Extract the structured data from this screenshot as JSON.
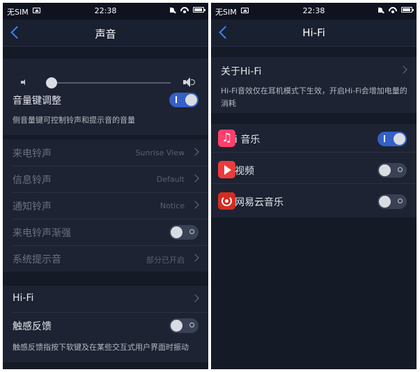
{
  "left": {
    "status": {
      "carrier": "无SIM",
      "time": "22:38"
    },
    "nav_title": "声音",
    "volume": {
      "level": 0.0
    },
    "volume_keys": {
      "label": "音量键调整",
      "toggle_on": true,
      "toggle_mark": "I"
    },
    "volume_note": "侧音量键可控制铃声和提示音的音量",
    "ringtones": [
      {
        "label": "来电铃声",
        "value": "Sunrise View"
      },
      {
        "label": "信息铃声",
        "value": "Default"
      },
      {
        "label": "通知铃声",
        "value": "Notice"
      },
      {
        "label": "来电铃声渐强",
        "toggle_on": false
      },
      {
        "label": "系统提示音",
        "value": "部分已开启"
      }
    ],
    "hifi": {
      "label": "Hi-Fi"
    },
    "haptic": {
      "label": "触感反馈",
      "toggle_on": false
    },
    "haptic_note": "触感反馈指按下软键及在某些交互式用户界面时振动"
  },
  "right": {
    "status": {
      "carrier": "无SIM",
      "time": "22:38"
    },
    "nav_title": "Hi-Fi",
    "about": {
      "label": "关于Hi-Fi"
    },
    "note": "Hi-Fi音效仅在耳机模式下生效，开启Hi-Fi会增加电量的消耗",
    "apps": [
      {
        "label": "i 音乐",
        "icon": "music-icon",
        "toggle_on": true
      },
      {
        "label": "视频",
        "icon": "video-icon",
        "toggle_on": false
      },
      {
        "label": "网易云音乐",
        "icon": "netease-icon",
        "toggle_on": false
      }
    ]
  },
  "colors": {
    "accent": "#3d82f5",
    "toggle_on": "#3460c7",
    "toggle_off": "#394154",
    "background": "#151a27",
    "card": "#1d2332"
  }
}
